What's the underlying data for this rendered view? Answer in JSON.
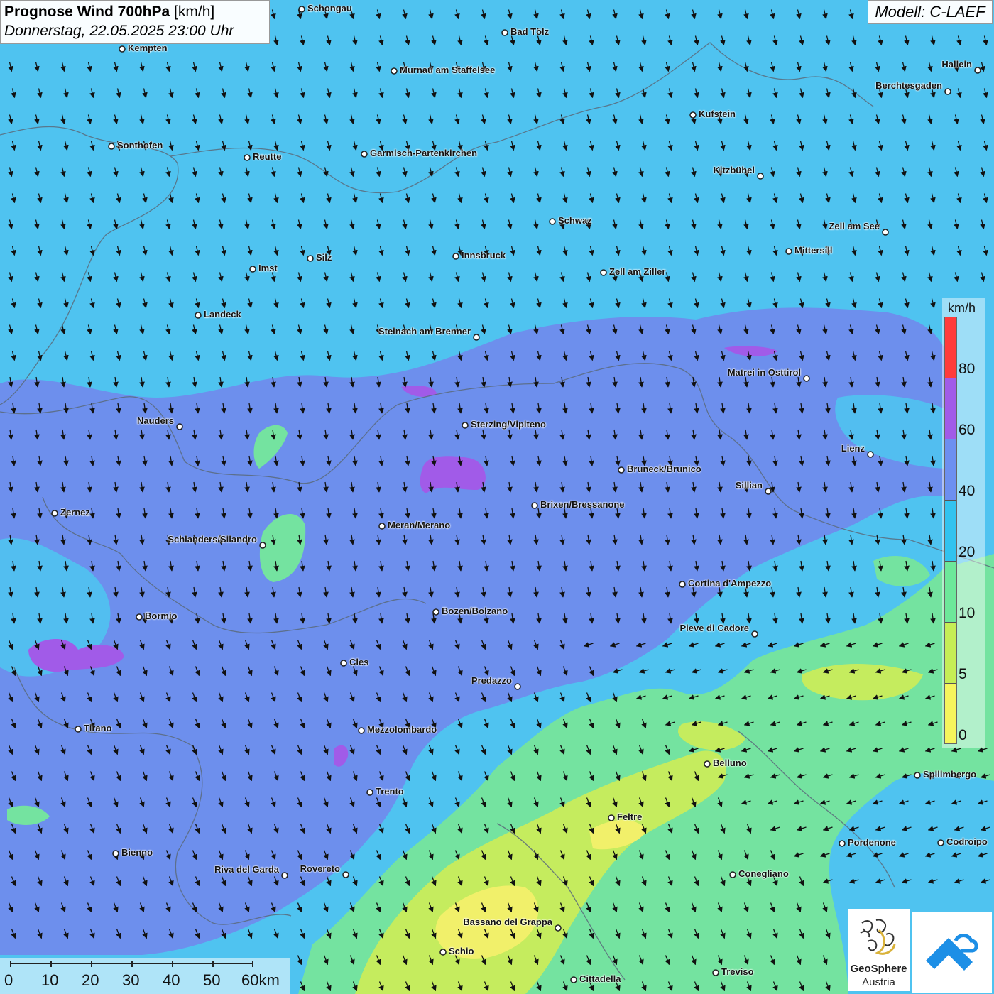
{
  "header": {
    "title_bold": "Prognose Wind 700hPa",
    "title_unit": "[km/h]",
    "datetime": "Donnerstag, 22.05.2025 23:00 Uhr"
  },
  "model": {
    "label": "Modell: C-LAEF"
  },
  "legend": {
    "unit": "km/h",
    "ticks": [
      "80",
      "60",
      "40",
      "20",
      "10",
      "5",
      "0"
    ],
    "colors": [
      "#ff3b3b",
      "#a15be8",
      "#6d8ff0",
      "#32c3ef",
      "#6de89a",
      "#c6ee55",
      "#f6f55c"
    ]
  },
  "scalebar": {
    "labels": [
      "0",
      "10",
      "20",
      "30",
      "40",
      "50",
      "60km"
    ]
  },
  "cities": [
    {
      "name": "Schongau"
    },
    {
      "name": "Bad Tölz"
    },
    {
      "name": "Kempten"
    },
    {
      "name": "Murnau am Staffelsee"
    },
    {
      "name": "Hallein"
    },
    {
      "name": "Berchtesgaden"
    },
    {
      "name": "Kufstein"
    },
    {
      "name": "Sonthofen"
    },
    {
      "name": "Reutte"
    },
    {
      "name": "Garmisch-Partenkirchen"
    },
    {
      "name": "Kitzbühel"
    },
    {
      "name": "Schwaz"
    },
    {
      "name": "Zell am See"
    },
    {
      "name": "Mittersill"
    },
    {
      "name": "Innsbruck"
    },
    {
      "name": "Silz"
    },
    {
      "name": "Imst"
    },
    {
      "name": "Zell am Ziller"
    },
    {
      "name": "Landeck"
    },
    {
      "name": "Steinach am Brenner"
    },
    {
      "name": "Matrei in Osttirol"
    },
    {
      "name": "Nauders"
    },
    {
      "name": "Sterzing/Vipiteno"
    },
    {
      "name": "Lienz"
    },
    {
      "name": "Bruneck/Brunico"
    },
    {
      "name": "Sillian"
    },
    {
      "name": "Zernez"
    },
    {
      "name": "Brixen/Bressanone"
    },
    {
      "name": "Meran/Merano"
    },
    {
      "name": "Schlanders/Silandro"
    },
    {
      "name": "Cortina d'Ampezzo"
    },
    {
      "name": "Bozen/Bolzano"
    },
    {
      "name": "Bormio"
    },
    {
      "name": "Pieve di Cadore"
    },
    {
      "name": "Cles"
    },
    {
      "name": "Predazzo"
    },
    {
      "name": "Tirano"
    },
    {
      "name": "Mezzolombardo"
    },
    {
      "name": "Belluno"
    },
    {
      "name": "Spilimbergo"
    },
    {
      "name": "Trento"
    },
    {
      "name": "Feltre"
    },
    {
      "name": "Pordenone"
    },
    {
      "name": "Codroipo"
    },
    {
      "name": "Bienno"
    },
    {
      "name": "Riva del Garda"
    },
    {
      "name": "Rovereto"
    },
    {
      "name": "Conegliano"
    },
    {
      "name": "Bassano del Grappa"
    },
    {
      "name": "Schio"
    },
    {
      "name": "Treviso"
    },
    {
      "name": "Cittadella"
    }
  ],
  "logos": {
    "geosphere_line1": "GeoSphere",
    "geosphere_line2": "Austria"
  },
  "colors": {
    "band_20_40": "#4fc3f0",
    "band_40_60": "#6f8cec",
    "band_60_80": "#a15be8",
    "band_10_20": "#74e3a0",
    "band_5_10": "#c5ec5e",
    "band_0_5": "#f1f06a",
    "arrow": "#111111"
  }
}
